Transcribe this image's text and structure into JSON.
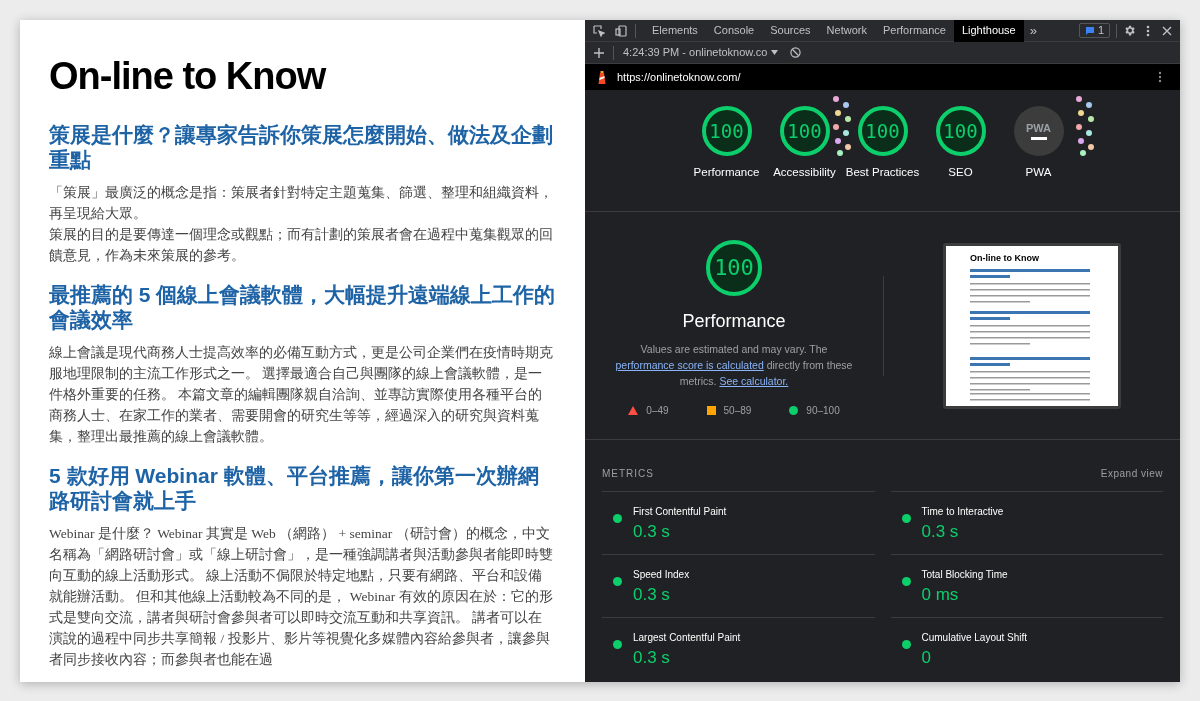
{
  "article": {
    "site_title": "On-line to Know",
    "sections": [
      {
        "heading": "策展是什麼？讓專家告訴你策展怎麼開始、做法及企劃重點",
        "paragraphs": [
          "「策展」最廣泛的概念是指：策展者針對特定主題蒐集、篩選、整理和組織資料，再呈現給大眾。",
          "策展的目的是要傳達一個理念或觀點；而有計劃的策展者會在過程中蒐集觀眾的回饋意見，作為未來策展的參考。"
        ]
      },
      {
        "heading": "最推薦的 5 個線上會議軟體，大幅提升遠端線上工作的會議效率",
        "paragraphs": [
          "線上會議是現代商務人士提高效率的必備互動方式，更是公司企業們在疫情時期克服地理限制的主流工作形式之一。 選擇最適合自己與團隊的線上會議軟體，是一件格外重要的任務。 本篇文章的編輯團隊親自洽詢、並專訪實際使用各種平台的商務人士、在家工作的業者、需要開會的研究生等等，經過深入的研究與資料蒐集，整理出最推薦的線上會議軟體。"
        ]
      },
      {
        "heading": "5 款好用 Webinar 軟體、平台推薦，讓你第一次辦網路研討會就上手",
        "paragraphs": [
          "Webinar 是什麼？ Webinar 其實是 Web （網路） + seminar （研討會）的概念，中文名稱為「網路研討會」或「線上研討會」，是一種強調講者與活動參與者能即時雙向互動的線上活動形式。 線上活動不侷限於特定地點，只要有網路、平台和設備就能辦活動。 但和其他線上活動較為不同的是， Webinar 有效的原因在於：它的形式是雙向交流，講者與研討會參與者可以即時交流互動和共享資訊。 講者可以在演說的過程中同步共享簡報 / 投影片、影片等視覺化多媒體內容給參與者，讓參與者同步接收內容；而參與者也能在過"
        ]
      }
    ]
  },
  "devtools": {
    "tabs": [
      {
        "label": "Elements",
        "selected": false
      },
      {
        "label": "Console",
        "selected": false
      },
      {
        "label": "Sources",
        "selected": false
      },
      {
        "label": "Network",
        "selected": false
      },
      {
        "label": "Performance",
        "selected": false
      },
      {
        "label": "Lighthouse",
        "selected": true
      }
    ],
    "overflow": "»",
    "issues_count": "1",
    "report_selector": "4:24:39 PM - onlinetoknow.co",
    "url": "https://onlinetoknow.com/",
    "gauges": [
      {
        "kind": "score",
        "score": "100",
        "label": "Performance"
      },
      {
        "kind": "score",
        "score": "100",
        "label": "Accessibility"
      },
      {
        "kind": "score",
        "score": "100",
        "label": "Best Practices"
      },
      {
        "kind": "score",
        "score": "100",
        "label": "SEO"
      },
      {
        "kind": "pwa",
        "score": "PWA",
        "label": "PWA"
      }
    ],
    "performance": {
      "score": "100",
      "title": "Performance",
      "description_before": "Values are estimated and may vary. The ",
      "link_score": "performance score is calculated",
      "description_middle": " directly from these metrics. ",
      "link_calculator": "See calculator.",
      "legend": [
        {
          "kind": "fail",
          "range": "0–49"
        },
        {
          "kind": "average",
          "range": "50–89"
        },
        {
          "kind": "pass",
          "range": "90–100"
        }
      ],
      "thumbnail_title": "On-line to Know"
    },
    "metrics_title": "METRICS",
    "expand": "Expand view",
    "metrics": [
      {
        "kind": "pass",
        "name": "First Contentful Paint",
        "value": "0.3 s"
      },
      {
        "kind": "pass",
        "name": "Time to Interactive",
        "value": "0.3 s"
      },
      {
        "kind": "pass",
        "name": "Speed Index",
        "value": "0.3 s"
      },
      {
        "kind": "pass",
        "name": "Total Blocking Time",
        "value": "0 ms"
      },
      {
        "kind": "pass",
        "name": "Largest Contentful Paint",
        "value": "0.3 s"
      },
      {
        "kind": "pass",
        "name": "Cumulative Layout Shift",
        "value": "0"
      }
    ]
  }
}
